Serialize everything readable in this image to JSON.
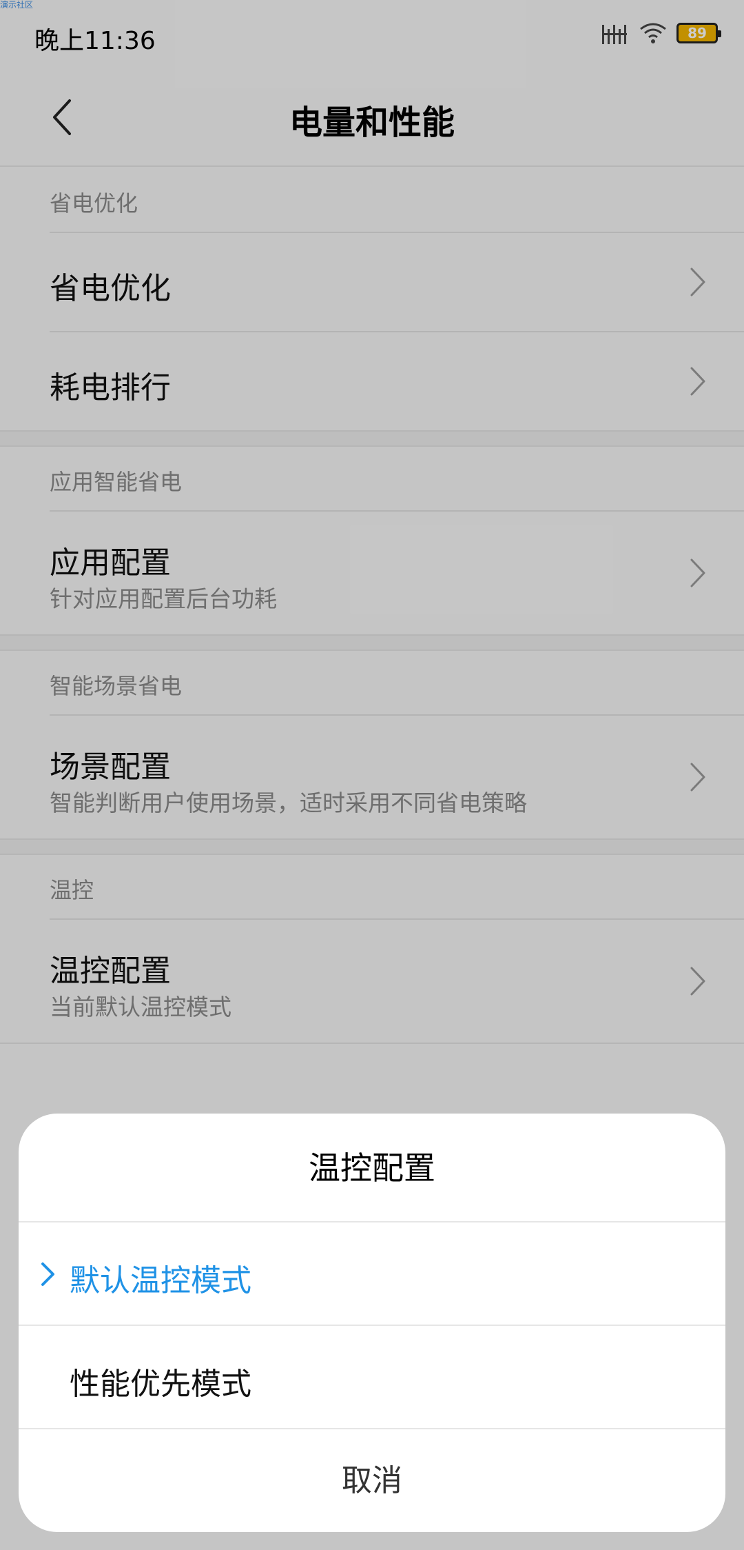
{
  "watermark": "演示社区",
  "status": {
    "time": "晚上11:36",
    "battery": "89",
    "icons": [
      "signal-icon",
      "wifi-icon",
      "battery-icon"
    ]
  },
  "header": {
    "back_icon": "chevron-left-icon",
    "title": "电量和性能"
  },
  "sections": [
    {
      "header": "省电优化",
      "rows": [
        {
          "title": "省电优化",
          "subtitle": ""
        },
        {
          "title": "耗电排行",
          "subtitle": ""
        }
      ]
    },
    {
      "header": "应用智能省电",
      "rows": [
        {
          "title": "应用配置",
          "subtitle": "针对应用配置后台功耗"
        }
      ]
    },
    {
      "header": "智能场景省电",
      "rows": [
        {
          "title": "场景配置",
          "subtitle": "智能判断用户使用场景，适时采用不同省电策略"
        }
      ]
    },
    {
      "header": "温控",
      "rows": [
        {
          "title": "温控配置",
          "subtitle": "当前默认温控模式"
        }
      ]
    }
  ],
  "sheet": {
    "title": "温控配置",
    "options": [
      {
        "label": "默认温控模式",
        "selected": true
      },
      {
        "label": "性能优先模式",
        "selected": false
      }
    ],
    "cancel": "取消"
  },
  "colors": {
    "accent": "#1f92e6",
    "battery": "#f3b400",
    "background": "#f7f7f7"
  }
}
